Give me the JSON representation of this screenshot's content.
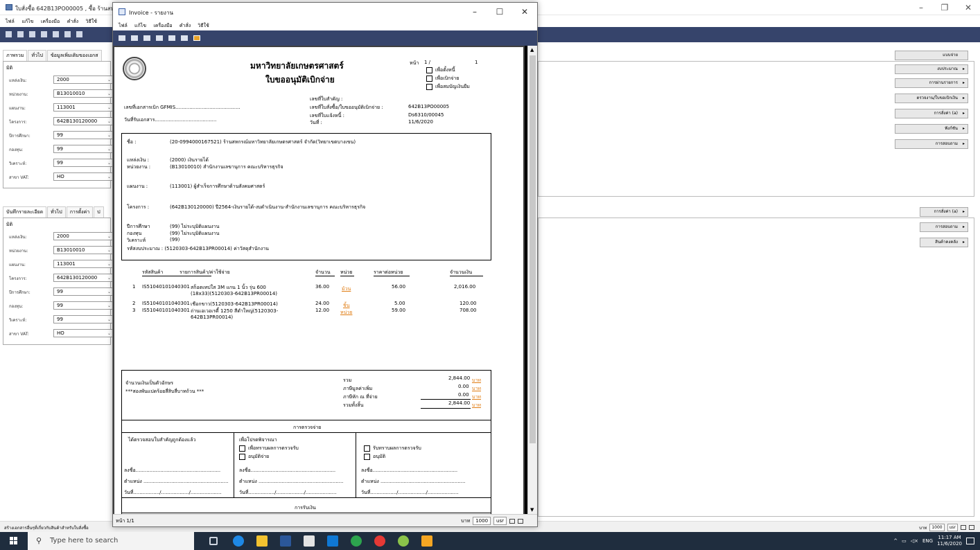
{
  "bg": {
    "title": "ใบสั่งซื้อ 642B13PO00005 , ซื้อ ร้านสหกร",
    "menu": [
      "ไฟล์",
      "แก้ไข",
      "เครื่องมือ",
      "คำสั่ง",
      "วิธีใช้"
    ],
    "top_tabs": [
      "ภาพรวม",
      "ทั่วไป",
      "ข้อมูลเพิ่มเติมของเอกส"
    ],
    "top_dim_label": "มิติ",
    "top_fields": [
      {
        "label": "แหล่งเงิน:",
        "value": "2000"
      },
      {
        "label": "หน่วยงาน:",
        "value": "B13010010"
      },
      {
        "label": "แผนงาน:",
        "value": "113001"
      },
      {
        "label": "โครงการ:",
        "value": "642B130120000"
      },
      {
        "label": "ปีการศึกษา:",
        "value": "99"
      },
      {
        "label": "กองทุน:",
        "value": "99"
      },
      {
        "label": "วิเคราะห์:",
        "value": "99"
      },
      {
        "label": "สาขา VAT:",
        "value": "HO"
      }
    ],
    "bottom_tabs": [
      "บันทึกรายละเอียด",
      "ทั่วไป",
      "การตั้งค่า",
      "ป"
    ],
    "bottom_dim_label": "มิติ",
    "bottom_fields": [
      {
        "label": "แหล่งเงิน:",
        "value": "2000"
      },
      {
        "label": "หน่วยงาน:",
        "value": "B13010010"
      },
      {
        "label": "แผนงาน:",
        "value": "113001"
      },
      {
        "label": "โครงการ:",
        "value": "642B130120000"
      },
      {
        "label": "ปีการศึกษา:",
        "value": "99"
      },
      {
        "label": "กองทุน:",
        "value": "99"
      },
      {
        "label": "วิเคราะห์:",
        "value": "99"
      },
      {
        "label": "สาขา VAT:",
        "value": "HO"
      }
    ],
    "right_buttons_top": [
      "แบบจ่าย",
      "งบประมาณ",
      "การผ่านรายการ",
      "ตรวจงาน/ใบขอเบิกเงิน",
      "การสั่งค่า (a)",
      "ฟังก์ชัน",
      "การสอบถาม"
    ],
    "right_buttons_bottom": [
      "การสั่งค่า (a)",
      "การสอบถาม",
      "สินค้าคงคลัง"
    ],
    "status_left": "สร้างเอกสารอื่นๆที่เกี่ยวกับสินค้าสำหรับใบสั่งซื้อ",
    "status_currency": "บาท",
    "status_num": "1000",
    "status_user": "usr"
  },
  "dialog": {
    "title": "Invoice - รายงาน",
    "menu": [
      "ไฟล์",
      "แก้ไข",
      "เครื่องมือ",
      "คำสั่ง",
      "วิธีใช้"
    ],
    "status_page": "หน้า 1/1",
    "status_currency": "บาท",
    "status_num": "1000",
    "status_user": "usr"
  },
  "doc": {
    "org": "มหาวิทยาลัยเกษตรศาสตร์",
    "title": "ใบขออนุมัติเบิกจ่าย",
    "page_label": "หน้า",
    "page_no": "1 /",
    "page_total": "1",
    "checks": [
      "เพื่อตั้งหนี้",
      "เพื่อเบิกจ่าย",
      "เพื่อสมบัญเงินยืม"
    ],
    "gfmis": "เลขที่เอกสารเบิก GFMIS..........................................",
    "recv_date": "วันที่รับเอกสาร........................................",
    "ref_labels": [
      "เลขที่ใบสำคัญ :",
      "เลขที่ใบสั่งซื้อ/ใบขออนุมัติเบิกจ่าย :",
      "เลขที่ใบแจ้งหนี้ :",
      "วันที่ :"
    ],
    "ref_values": [
      "",
      "642B13PO00005",
      "Ds6310/00045",
      "11/6/2020"
    ],
    "info_label_name": "ชื่อ :",
    "info_name": "(20-0994000167521) ร้านสหกรณ์มหาวิทยาลัยเกษตรศาสตร์ จำกัด(วิทยาเขตบางเขน)",
    "info_fund_label": "แหล่งเงิน :",
    "info_fund": "(2000) เงินรายได้",
    "info_unit_label": "หน่วยงาน :",
    "info_unit": "(B13010010) สำนักงานเลขานุการ คณะบริหารธุรกิจ",
    "info_plan_label": "แผนงาน :",
    "info_plan": "(113001) ผู้สำเร็จการศึกษาด้านสังคมศาสตร์",
    "info_proj_label": "โครงการ :",
    "info_proj": "(642B130120000) ปี2564-เงินรายได้-งบดำเนินงาน-สำนักงานเลขานุการ คณะบริหารธุรกิจ",
    "info_year_label": "ปีการศึกษา",
    "info_year": "(99) ไม่ระบุมิติแผนงาน",
    "info_fundx_label": "กองทุน",
    "info_fundx": "(99) ไม่ระบุมิติแผนงาน",
    "info_anal_label": "วิเคราะห์",
    "info_anal": "(99)",
    "info_budget": "รหัสงบประมาณ  : (5120303-642B13PR00014) ค่าวัสดุสำนักงาน",
    "col_code": "รหัสสินค้า",
    "col_desc": "รายการสินค้า/ค่าใช้จ่าย",
    "col_qty": "จำนวน",
    "col_unit": "หน่วย",
    "col_price": "ราคาต่อหน่วย",
    "col_amount": "จำนวนเงิน",
    "lines": [
      {
        "no": "1",
        "code": "IS51040101040301",
        "desc1": "สก็อตเทปใส 3M แกน 1 นิ้ว รุ่น 600",
        "desc2": "(18x33)(5120303-642B13PR00014)",
        "qty": "36.00",
        "unit": "ม้วน",
        "price": "56.00",
        "amount": "2,016.00"
      },
      {
        "no": "2",
        "code": "IS51040101040301",
        "desc1": "เชือกขาว(5120303-642B13PR00014)",
        "desc2": "",
        "qty": "24.00",
        "unit": "ชิ้น",
        "price": "5.00",
        "amount": "120.00"
      },
      {
        "no": "3",
        "code": "IS51040101040301",
        "desc1": "ถ่านเอเวอเรดี้ 1250 สีดำใหญ่(5120303-",
        "desc2": "642B13PR00014)",
        "qty": "12.00",
        "unit": "หน่วย",
        "price": "59.00",
        "amount": "708.00"
      }
    ],
    "words_label": "จำนวนเงินเป็นตัวอักษร",
    "words": "***สองพันแปดร้อยสี่สิบสี่บาทถ้วน ***",
    "sum_labels": [
      "รวม",
      "ภาษีมูลค่าเพิ่ม",
      "ภาษีหัก ณ ที่จ่าย",
      "รวมทั้งสิ้น"
    ],
    "sum_values": [
      "2,844.00",
      "0.00",
      "0.00",
      "2,844.00"
    ],
    "baht": "บาท",
    "section_check": "การตรวจจ่าย",
    "verify1": "ได้ตรวจสอบใบสำคัญถูกต้องแล้ว",
    "verify2": "เพื่อโปรดพิจารณา",
    "opt_ack": "เพื่อทราบผลการตรวจรับ",
    "opt_approve": "อนุมัติจ่าย",
    "opt_ack2": "รับทราบผลการตรวจรับ",
    "opt_approve2": "อนุมัติ",
    "sign": "ลงชื่อ.......................................................",
    "pos": "ตำแหน่ง .......................................................",
    "date": "วันที่................./................../....................",
    "section_pay": "การรับเงิน"
  },
  "taskbar": {
    "search_placeholder": "Type here to search",
    "lang": "ENG",
    "time": "11:17 AM",
    "date": "11/6/2020"
  }
}
